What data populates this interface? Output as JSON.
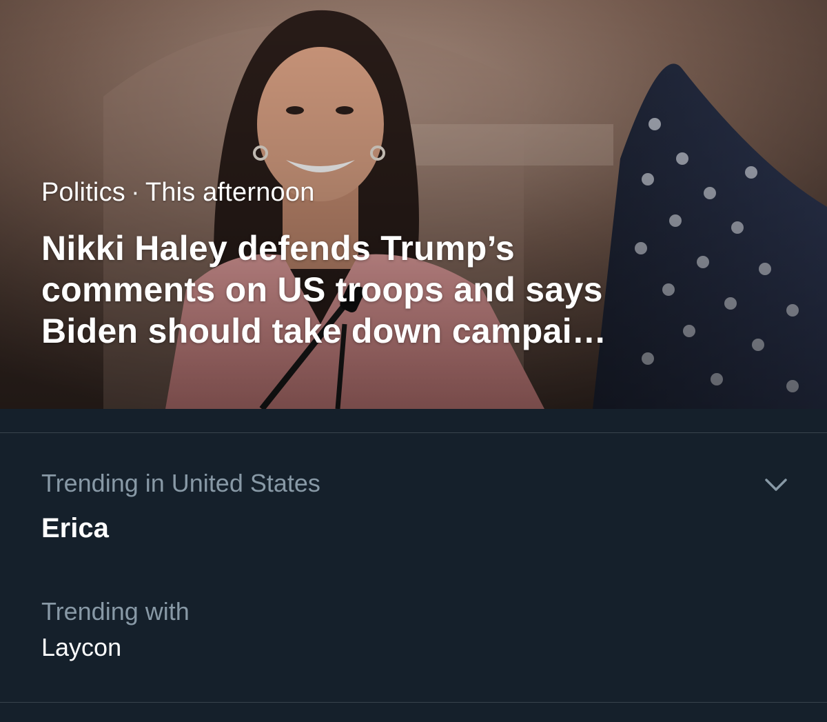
{
  "story": {
    "category": "Politics",
    "separator": "·",
    "time": "This afternoon",
    "headline_lines": [
      "Nikki Haley defends Trump’s",
      "comments on US troops and says",
      "Biden should take down campai…"
    ]
  },
  "trend": {
    "context": "Trending in United States",
    "name": "Erica",
    "with_label": "Trending with",
    "with_value": "Laycon",
    "menu_icon": "chevron-down-icon"
  },
  "colors": {
    "background": "#15202b",
    "secondary_text": "#8899a6",
    "primary_text": "#ffffff",
    "divider": "#38444d",
    "dress": "#e7a1a0"
  }
}
